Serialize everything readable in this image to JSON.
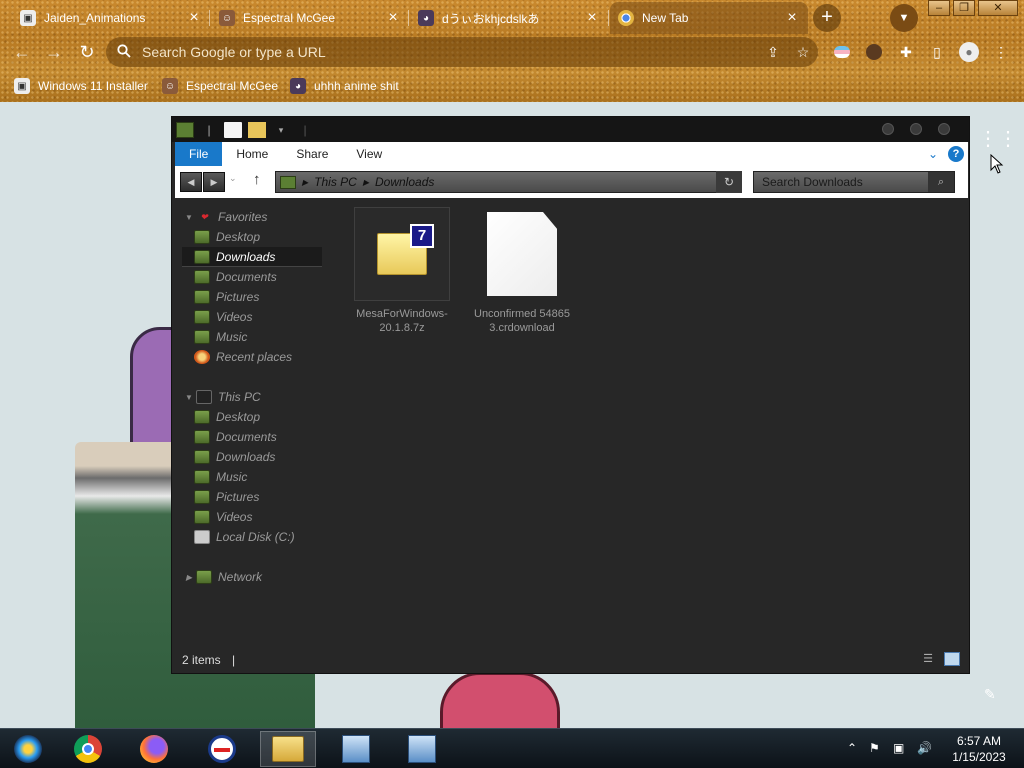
{
  "browser": {
    "tabs": [
      {
        "title": "Jaiden_Animations",
        "favicon": "jaiden-favicon",
        "active": false
      },
      {
        "title": "Espectral McGee",
        "favicon": "avatar-favicon",
        "active": false
      },
      {
        "title": "dうぃおkhjcdslkあ",
        "favicon": "anime-favicon",
        "active": false
      },
      {
        "title": "New Tab",
        "favicon": "chrome-favicon",
        "active": true
      }
    ],
    "omnibox_placeholder": "Search Google or type a URL",
    "bookmarks": [
      {
        "label": "Windows 11 Installer",
        "icon": "installer-icon"
      },
      {
        "label": "Espectral McGee",
        "icon": "avatar-icon"
      },
      {
        "label": "uhhh anime shit",
        "icon": "anime-icon"
      }
    ],
    "theme_color": "#c08530"
  },
  "explorer": {
    "ribbon_tabs": [
      "File",
      "Home",
      "Share",
      "View"
    ],
    "address": {
      "crumbs": [
        "This PC",
        "Downloads"
      ]
    },
    "search_placeholder": "Search Downloads",
    "nav": {
      "favorites_label": "Favorites",
      "favorites": [
        "Desktop",
        "Downloads",
        "Documents",
        "Pictures",
        "Videos",
        "Music",
        "Recent places"
      ],
      "thispc_label": "This PC",
      "thispc": [
        "Desktop",
        "Documents",
        "Downloads",
        "Music",
        "Pictures",
        "Videos",
        "Local Disk (C:)"
      ],
      "network_label": "Network"
    },
    "files": [
      {
        "name": "MesaForWindows-20.1.8.7z",
        "type": "7z-archive"
      },
      {
        "name": "Unconfirmed 548653.crdownload",
        "type": "blank-document"
      }
    ],
    "status": "2 items",
    "selected_nav": "Downloads"
  },
  "taskbar": {
    "apps": [
      "start-orb",
      "chrome",
      "firefox",
      "ie-like",
      "file-explorer",
      "installer-1",
      "installer-2"
    ],
    "time": "6:57 AM",
    "date": "1/15/2023",
    "active_app": "file-explorer"
  }
}
